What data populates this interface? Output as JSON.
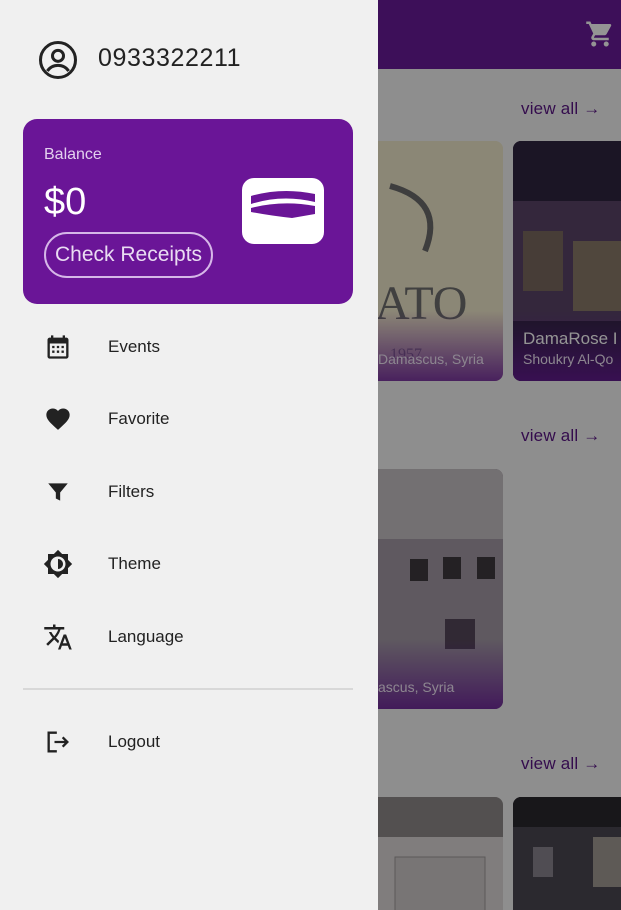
{
  "app": {
    "cart_icon": "shopping-cart-icon",
    "view_all_label": "view all →",
    "cards": [
      {
        "title": "",
        "location": "Damascus, Syria"
      },
      {
        "title": "DamaRose I",
        "location": "Shoukry Al-Qo"
      },
      {
        "title": "",
        "location": "ascus, Syria"
      }
    ]
  },
  "drawer": {
    "profile_icon": "account-circle-icon",
    "phone": "0933322211",
    "balance": {
      "label": "Balance",
      "amount": "$0",
      "button": "Check Receipts",
      "icon": "wallet-icon"
    },
    "menu": [
      {
        "label": "Events",
        "icon": "calendar-icon"
      },
      {
        "label": "Favorite",
        "icon": "heart-icon"
      },
      {
        "label": "Filters",
        "icon": "filter-icon"
      },
      {
        "label": "Theme",
        "icon": "brightness-icon"
      },
      {
        "label": "Language",
        "icon": "translate-icon"
      }
    ],
    "logout": {
      "label": "Logout",
      "icon": "logout-icon"
    }
  },
  "colors": {
    "primary": "#6a1b9a",
    "card": "#6a1597",
    "drawer_bg": "#f0f0f0"
  }
}
